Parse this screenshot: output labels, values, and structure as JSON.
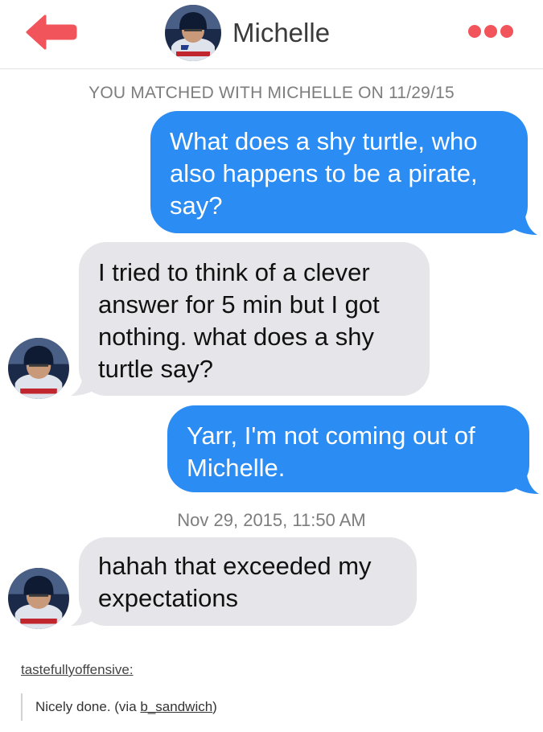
{
  "header": {
    "contact_name": "Michelle"
  },
  "match_note": "YOU MATCHED WITH MICHELLE ON 11/29/15",
  "messages": [
    {
      "from": "me",
      "text": "What does a shy turtle, who\nalso happens to be a pirate,\nsay?"
    },
    {
      "from": "Michelle",
      "text": "I tried to think of a clever\nanswer for 5 min but I got\nnothing. what does a shy\nturtle say?"
    },
    {
      "from": "me",
      "text": "Yarr, I'm not coming out of\nMichelle."
    },
    {
      "from": "Michelle",
      "text": "hahah that exceeded my\nexpectations"
    }
  ],
  "timestamp": "Nov 29, 2015, 11:50 AM",
  "post": {
    "author": "tastefullyoffensive:",
    "quote_prefix": "Nicely done. (via ",
    "quote_link": "b_sandwich",
    "quote_suffix": ")"
  },
  "colors": {
    "sent_bubble": "#2b8cf3",
    "received_bubble": "#e6e6ea",
    "accent": "#f2545b"
  },
  "icons": [
    "back-arrow-icon",
    "more-options-icon"
  ]
}
